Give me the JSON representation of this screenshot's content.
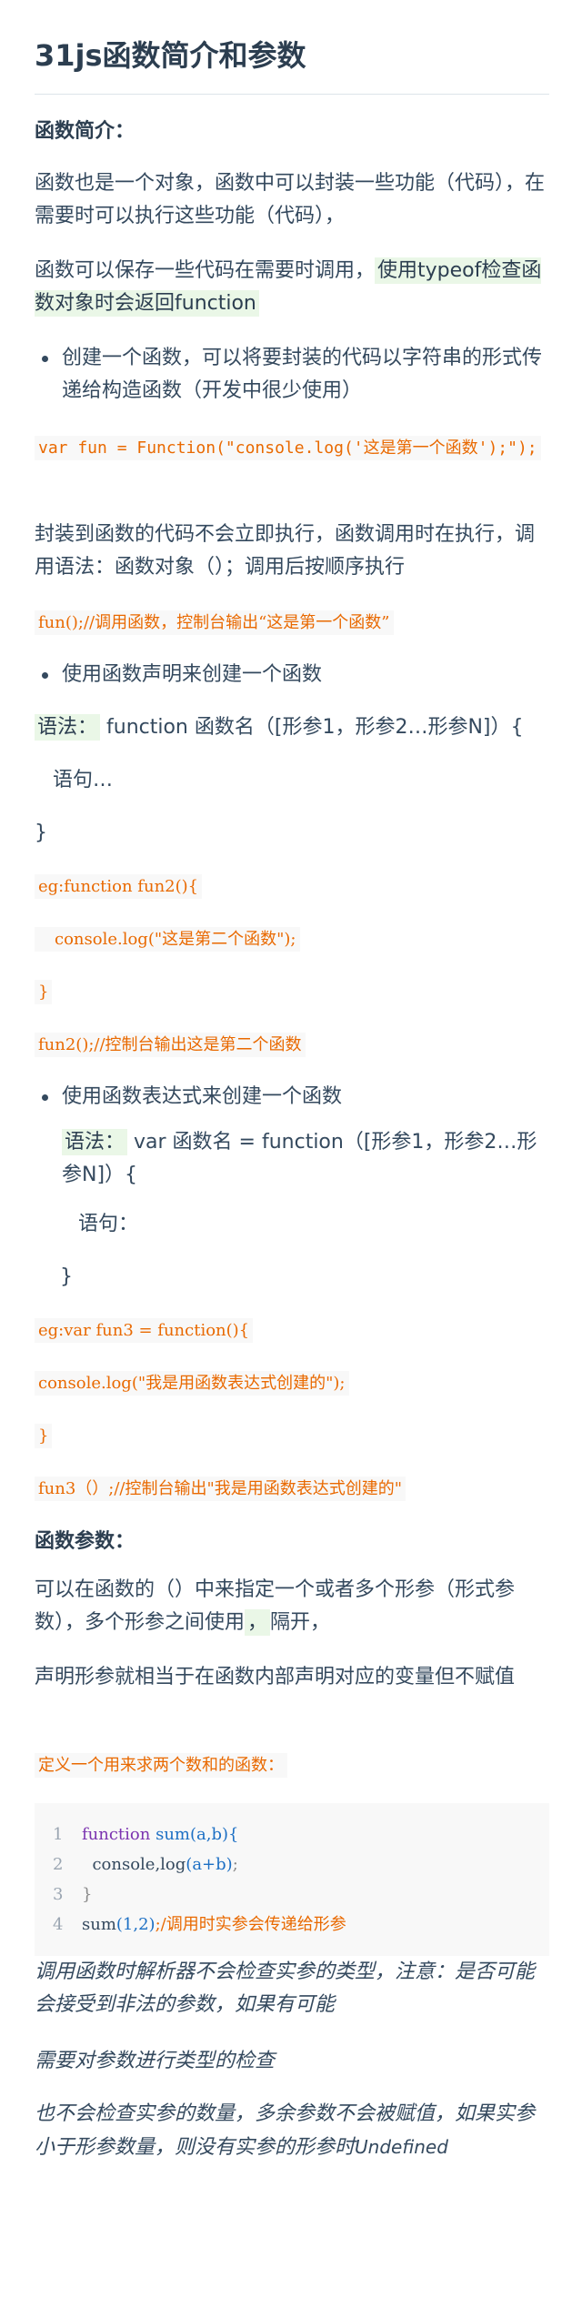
{
  "title": "31js函数简介和参数",
  "sec_intro": {
    "heading": "函数简介：",
    "p1": "函数也是一个对象，函数中可以封装一些功能（代码），在需要时可以执行这些功能（代码），",
    "p2_plain": "函数可以保存一些代码在需要时调用，",
    "p2_hl": "使用typeof检查函数对象时会返回function",
    "bullet1": "创建一个函数，可以将要封装的代码以字符串的形式传递给构造函数（开发中很少使用）",
    "code1": "var fun = Function(\"console.log('这是第一个函数');\");",
    "p3": "封装到函数的代码不会立即执行，函数调用时在执行，调用语法：函数对象（）；调用后按顺序执行",
    "code2": "fun();//调用函数，控制台输出“这是第一个函数”",
    "bullet2": "使用函数声明来创建一个函数",
    "syntax_label": "语法：",
    "syntax1": " function 函数名（[形参1，形参2…形参N]）{",
    "stmt1": "语句…",
    "close1": "}",
    "code3": "eg:function fun2(){",
    "code4": "console.log(\"这是第二个函数\");",
    "code5": "}",
    "code6": "fun2();//控制台输出这是第二个函数",
    "bullet3": "使用函数表达式来创建一个函数",
    "syntax2": " var  函数名 = function（[形参1，形参2…形参N]）{",
    "stmt2": "语句：",
    "close2": "}",
    "code7": "eg:var fun3 = function(){",
    "code8": "console.log(\"我是用函数表达式创建的\");",
    "code9": "}",
    "code10": "fun3（）;//控制台输出\"我是用函数表达式创建的\""
  },
  "sec_params": {
    "heading": "函数参数：",
    "p1a": "可以在函数的（）中来指定一个或者多个形参（形式参数），多个形参之间使用",
    "p1_hl": "，",
    "p1b": "隔开，",
    "p2": "声明形参就相当于在函数内部声明对应的变量但不赋值",
    "code_label": "定义一个用来求两个数和的函数：",
    "code_block": {
      "l1_num": "1",
      "l1_kw": "function",
      "l1_fn": "sum",
      "l1_rest": "(a,b){",
      "l2_num": "2",
      "l2_text": "console,log",
      "l2_args": "(a+b)",
      "l2_end": ";",
      "l3_num": "3",
      "l3_text": "}",
      "l4_num": "4",
      "l4_fn": "sum",
      "l4_args": "(1,2)",
      "l4_comment": ";/调用时实参会传递给形参"
    },
    "note1": "调用函数时解析器不会检查实参的类型，注意：是否可能会接受到非法的参数，如果有可能",
    "note2": "需要对参数进行类型的检查",
    "note3a": "也不会检查实参的数量，多余参数不会被赋值，如果实参小于形参数量，则没有实参的形参时",
    "note3b": "Undefined"
  }
}
